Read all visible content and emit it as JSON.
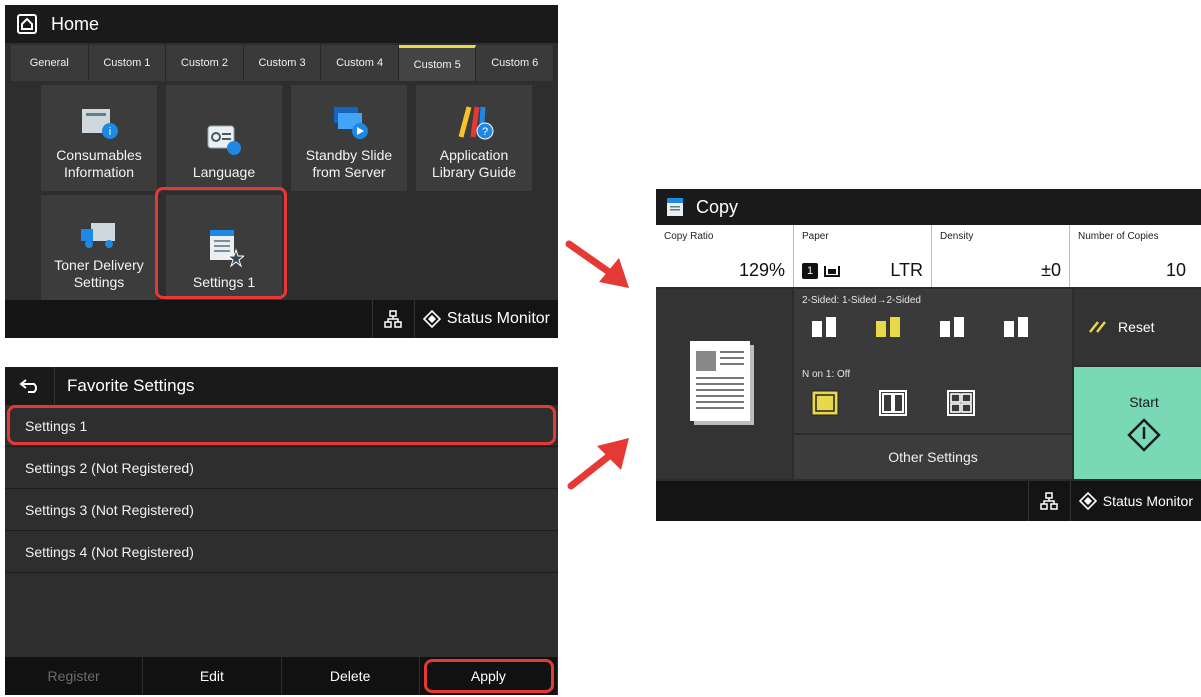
{
  "home": {
    "title": "Home",
    "tabs": [
      "General",
      "Custom 1",
      "Custom 2",
      "Custom 3",
      "Custom 4",
      "Custom 5",
      "Custom 6"
    ],
    "active_tab": "Custom 5",
    "tiles": {
      "consumables": [
        "Consumables",
        "Information"
      ],
      "language": [
        "Language"
      ],
      "standby": [
        "Standby Slide",
        "from Server"
      ],
      "app_library": [
        "Application",
        "Library Guide"
      ],
      "toner": [
        "Toner Delivery",
        "Settings"
      ],
      "settings1": [
        "Settings 1"
      ]
    },
    "status_monitor": "Status Monitor"
  },
  "favorites": {
    "title": "Favorite Settings",
    "items": [
      "Settings 1",
      "Settings 2 (Not Registered)",
      "Settings 3 (Not Registered)",
      "Settings 4 (Not Registered)"
    ],
    "actions": {
      "register": "Register",
      "edit": "Edit",
      "delete": "Delete",
      "apply": "Apply"
    }
  },
  "copy": {
    "title": "Copy",
    "copy_ratio_label": "Copy Ratio",
    "copy_ratio_value": "129%",
    "paper_label": "Paper",
    "paper_value": "LTR",
    "paper_tray": "1",
    "density_label": "Density",
    "density_value": "±0",
    "copies_label": "Number of Copies",
    "copies_value": "10",
    "two_sided_label": "2-Sided: 1-Sided→2-Sided",
    "n_on_1_label": "N on 1: Off",
    "other_settings": "Other Settings",
    "reset": "Reset",
    "start": "Start",
    "status_monitor": "Status Monitor"
  },
  "colors": {
    "highlight_red": "#e53935",
    "active_yellow": "#e8d84a",
    "start_green": "#79d9b7"
  }
}
